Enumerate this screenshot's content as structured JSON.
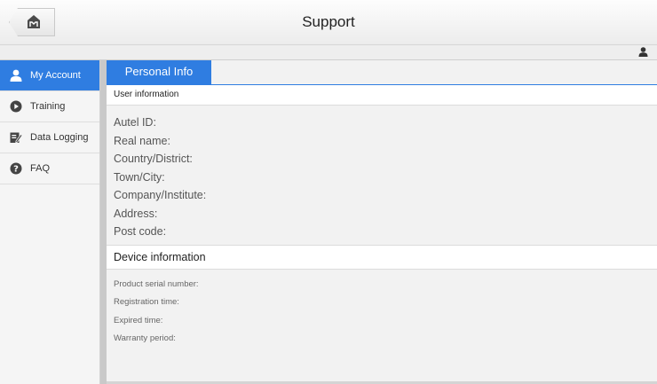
{
  "header": {
    "title": "Support",
    "home_icon": "home-icon"
  },
  "userstrip": {
    "icon": "user-icon"
  },
  "sidebar": {
    "items": [
      {
        "label": "My Account",
        "icon": "user-icon",
        "active": true
      },
      {
        "label": "Training",
        "icon": "play-circle-icon",
        "active": false
      },
      {
        "label": "Data Logging",
        "icon": "edit-note-icon",
        "active": false
      },
      {
        "label": "FAQ",
        "icon": "help-circle-icon",
        "active": false
      }
    ]
  },
  "main": {
    "tab": "Personal Info",
    "user_section": {
      "title": "User information",
      "fields": [
        "Autel ID:",
        "Real name:",
        "Country/District:",
        "Town/City:",
        "Company/Institute:",
        "Address:",
        "Post code:"
      ]
    },
    "device_section": {
      "title": "Device information",
      "fields": [
        "Product serial number:",
        "Registration time:",
        "Expired time:",
        "Warranty period:"
      ]
    }
  },
  "colors": {
    "accent": "#2f7de1",
    "background": "#f2f2f2"
  }
}
